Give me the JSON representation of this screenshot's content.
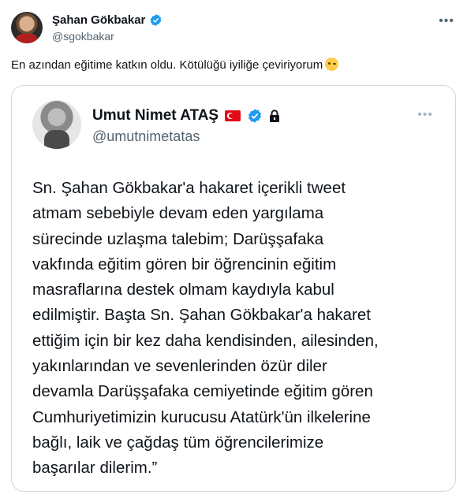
{
  "tweet": {
    "author_name": "Şahan Gökbakar",
    "author_handle": "@sgokbakar",
    "more_icon": "more-dots-icon",
    "text": "En azından eğitime katkın oldu. Kötülüğü iyiliğe çeviriyorum",
    "emoji": "winking-face-icon"
  },
  "quoted": {
    "author_name": "Umut Nimet ATAŞ",
    "author_handle": "@umutnimetatas",
    "badges": [
      "turkey-flag-icon",
      "verified-badge-icon",
      "lock-icon"
    ],
    "text_lines": [
      "Sn. Şahan Gökbakar'a hakaret içerikli tweet",
      "atmam sebebiyle devam eden yargılama",
      "sürecinde uzlaşma talebim; Darüşşafaka",
      "vakfında eğitim gören bir öğrencinin eğitim",
      "masraflarına destek olmam kaydıyla kabul",
      "edilmiştir. Başta Sn. Şahan Gökbakar'a hakaret",
      "ettiğim için bir kez daha kendisinden, ailesinden,",
      "yakınlarından ve sevenlerinden özür diler",
      "devamla Darüşşafaka cemiyetinde eğitim gören",
      "Cumhuriyetimizin kurucusu Atatürk'ün ilkelerine",
      "bağlı, laik ve çağdaş tüm öğrencilerimize",
      "başarılar dilerim.”"
    ]
  },
  "colors": {
    "verified": "#1d9bf0",
    "secondary_text": "#536471",
    "border": "#cfd9de"
  }
}
